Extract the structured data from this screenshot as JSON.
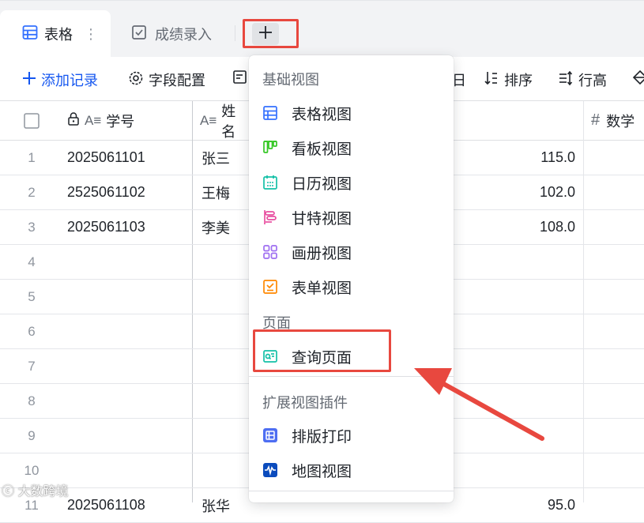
{
  "tabs": [
    {
      "label": "表格",
      "icon": "grid-table-icon",
      "active": true
    },
    {
      "label": "成绩录入",
      "icon": "form-check-icon",
      "active": false
    }
  ],
  "tab_more_label": "⋮",
  "add_view_label": "+",
  "toolbar": {
    "add_record": "添加记录",
    "field_config": "字段配置",
    "item_partial": "日",
    "sort": "排序",
    "row_height": "行高"
  },
  "table": {
    "columns": [
      {
        "label": "学号",
        "icon": "text-field-icon",
        "locked": true
      },
      {
        "label": "姓名",
        "icon": "text-field-icon"
      },
      {
        "label": "数学",
        "icon": "number-field-icon"
      }
    ],
    "rows": [
      {
        "num": "1",
        "id": "2025061101",
        "name": "张三",
        "score": "115.0"
      },
      {
        "num": "2",
        "id": "2525061102",
        "name": "王梅",
        "score": "102.0"
      },
      {
        "num": "3",
        "id": "2025061103",
        "name": "李美",
        "score": "108.0"
      },
      {
        "num": "4",
        "id": "",
        "name": "",
        "score": ""
      },
      {
        "num": "5",
        "id": "",
        "name": "",
        "score": ""
      },
      {
        "num": "6",
        "id": "",
        "name": "",
        "score": ""
      },
      {
        "num": "7",
        "id": "",
        "name": "",
        "score": ""
      },
      {
        "num": "8",
        "id": "",
        "name": "",
        "score": ""
      },
      {
        "num": "9",
        "id": "",
        "name": "",
        "score": ""
      },
      {
        "num": "10",
        "id": "",
        "name": "",
        "score": ""
      },
      {
        "num": "11",
        "id": "2025061108",
        "name": "张华",
        "score": "95.0"
      }
    ]
  },
  "menu": {
    "basic_title": "基础视图",
    "basic_items": [
      {
        "label": "表格视图",
        "icon": "grid-view-icon",
        "color": "#3370ff"
      },
      {
        "label": "看板视图",
        "icon": "kanban-view-icon",
        "color": "#34c724"
      },
      {
        "label": "日历视图",
        "icon": "calendar-view-icon",
        "color": "#14c0a7"
      },
      {
        "label": "甘特视图",
        "icon": "gantt-view-icon",
        "color": "#e84fa0"
      },
      {
        "label": "画册视图",
        "icon": "gallery-view-icon",
        "color": "#9f6ff1"
      },
      {
        "label": "表单视图",
        "icon": "form-view-icon",
        "color": "#ff8800"
      }
    ],
    "page_title": "页面",
    "page_items": [
      {
        "label": "查询页面",
        "icon": "query-page-icon",
        "color": "#14c0a7"
      }
    ],
    "plugin_title": "扩展视图插件",
    "plugin_items": [
      {
        "label": "排版打印",
        "icon": "print-layout-icon",
        "color": "#4e6ef2"
      },
      {
        "label": "地图视图",
        "icon": "map-view-icon",
        "color": "#0a4bbd"
      }
    ]
  },
  "accent_color": "#1456f0",
  "highlight_color": "#e8483f",
  "watermark": "大数跨境"
}
